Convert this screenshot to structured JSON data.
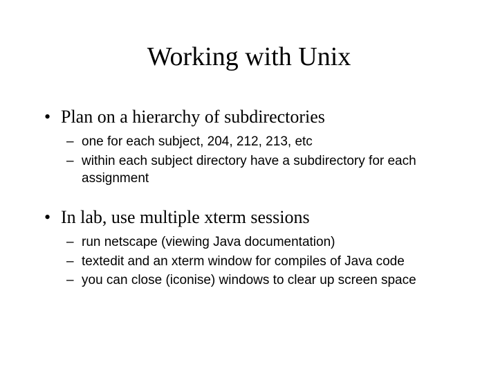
{
  "title": "Working with Unix",
  "bullets": [
    {
      "text": "Plan on a hierarchy of subdirectories",
      "subs": [
        "one for each subject, 204, 212, 213, etc",
        "within each subject directory have a subdirectory for each assignment"
      ]
    },
    {
      "text": "In lab, use multiple xterm sessions",
      "subs": [
        "run netscape (viewing Java documentation)",
        "textedit and an xterm window for compiles of Java code",
        "you can close (iconise) windows to clear up screen space"
      ]
    }
  ]
}
